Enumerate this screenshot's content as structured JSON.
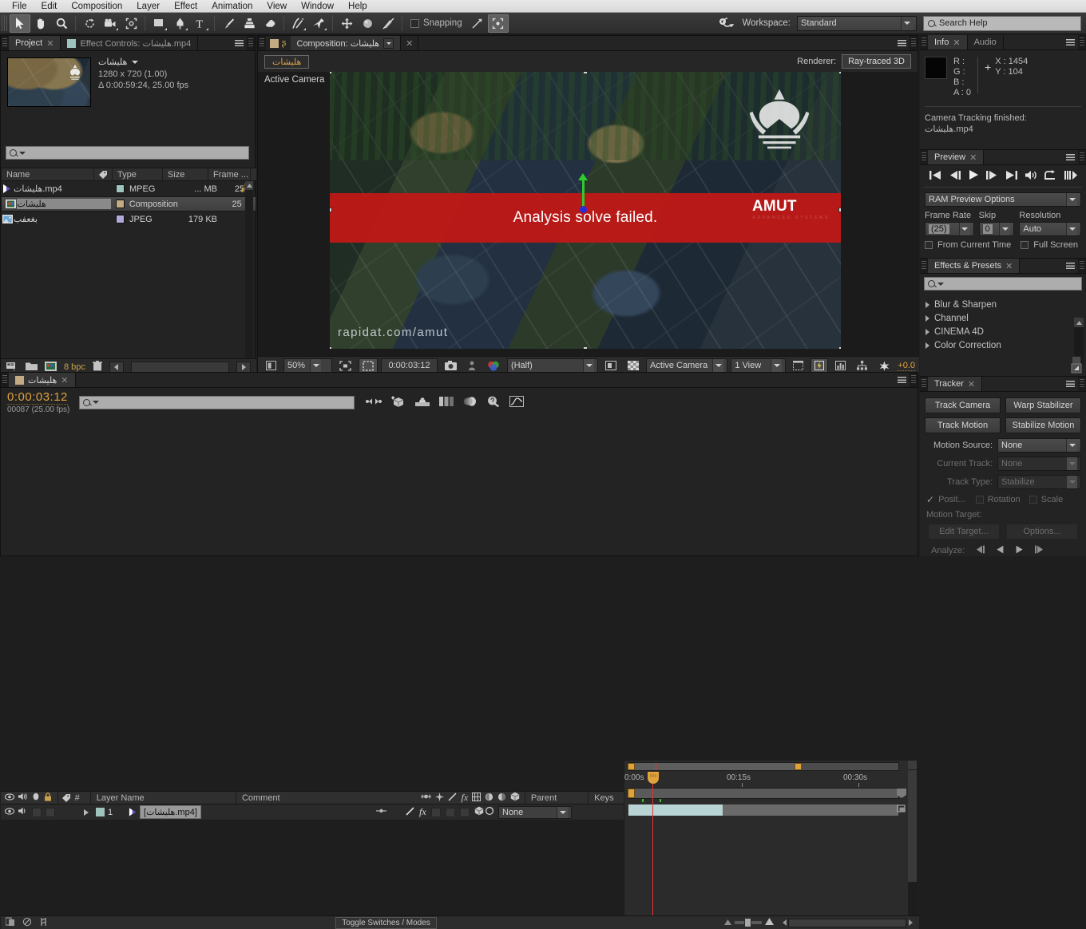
{
  "menu": {
    "items": [
      "File",
      "Edit",
      "Composition",
      "Layer",
      "Effect",
      "Animation",
      "View",
      "Window",
      "Help"
    ]
  },
  "toolbar": {
    "tools": [
      {
        "name": "selection-tool",
        "icon": "arrow",
        "active": true
      },
      {
        "name": "hand-tool",
        "icon": "hand",
        "active": false
      },
      {
        "name": "zoom-tool",
        "icon": "magnifier",
        "active": false
      },
      {
        "name": "rotation-tool",
        "icon": "rotate",
        "active": false
      },
      {
        "name": "camera-tool",
        "icon": "camera",
        "active": false
      },
      {
        "name": "pan-behind-tool",
        "icon": "anchor-region",
        "active": false
      },
      {
        "name": "shape-tool",
        "icon": "rectangle",
        "active": false
      },
      {
        "name": "pen-tool",
        "icon": "pen",
        "active": false
      },
      {
        "name": "type-tool",
        "icon": "type",
        "active": false
      },
      {
        "name": "brush-tool",
        "icon": "brush",
        "active": false
      },
      {
        "name": "clone-stamp-tool",
        "icon": "stamp",
        "active": false
      },
      {
        "name": "eraser-tool",
        "icon": "eraser",
        "active": false
      },
      {
        "name": "roto-brush-tool",
        "icon": "roto-brush",
        "active": false
      },
      {
        "name": "puppet-pin-tool",
        "icon": "pin",
        "active": false
      }
    ],
    "snapping_label": "Snapping",
    "snapping_checked": false,
    "workspace_label": "Workspace:",
    "workspace_value": "Standard",
    "search_help_placeholder": "Search Help"
  },
  "project_panel": {
    "tabs": [
      {
        "label": "Project",
        "active": true,
        "closable": true
      },
      {
        "label": "Effect Controls: هلیشات.mp4",
        "active": false,
        "closable": false
      }
    ],
    "selected_item": {
      "name": "هلیشات",
      "dimensions": "1280 x 720 (1.00)",
      "duration": "Δ 0:00:59:24, 25.00 fps"
    },
    "search_placeholder": "",
    "columns": [
      "Name",
      "Type",
      "Size",
      "Frame ..."
    ],
    "rows": [
      {
        "name": "هلیشات.mp4",
        "type": "MPEG",
        "size": "... MB",
        "frame": "25",
        "color": "#9fc3bd",
        "selected": false,
        "icon": "movie-icon"
      },
      {
        "name": "هلیشات",
        "type": "Composition",
        "size": "",
        "frame": "25",
        "color": "#c3ab83",
        "selected": true,
        "icon": "comp-icon"
      },
      {
        "name": "بغعفب",
        "type": "JPEG",
        "size": "179 KB",
        "frame": "",
        "color": "#b0aad9",
        "selected": false,
        "icon": "image-icon"
      }
    ],
    "bottom_bar": {
      "bit_depth": "8 bpc"
    }
  },
  "composition_panel": {
    "tab_label": "Composition: هلیشات",
    "comp_name_button": "هلیشات",
    "renderer_label": "Renderer:",
    "renderer_value": "Ray-traced 3D",
    "view_label": "Active Camera",
    "error_banner_text": "Analysis solve failed.",
    "error_banner_color": "#c21816",
    "watermark_text": "rapidat.com/amut",
    "logo_text": "AMUT",
    "logo_subtext": "ADVANCED SYSTEMS",
    "bottom_bar": {
      "zoom": "50%",
      "timecode": "0:00:03:12",
      "resolution": "(Half)",
      "camera_view": "Active Camera",
      "view_layout": "1 View",
      "exposure": "+0.0"
    }
  },
  "timeline_panel": {
    "tab_label": "هلیشات",
    "current_time": "0:00:03:12",
    "frame_info": "00087 (25.00 fps)",
    "search_placeholder": "",
    "columns": {
      "number": "#",
      "layer_name": "Layer Name",
      "comment": "Comment",
      "parent": "Parent",
      "keys": "Keys"
    },
    "layers": [
      {
        "index": "1",
        "name": "[هلیشات.mp4]",
        "parent": "None",
        "color": "#9fc3bd"
      }
    ],
    "ruler_labels": [
      "0:00s",
      "00:15s",
      "00:30s"
    ],
    "toggle_switches_label": "Toggle Switches / Modes"
  },
  "info_panel": {
    "tabs": [
      {
        "label": "Info",
        "active": true,
        "closable": true
      },
      {
        "label": "Audio",
        "active": false,
        "closable": false
      }
    ],
    "channels": [
      {
        "label": "R :",
        "value": ""
      },
      {
        "label": "G :",
        "value": ""
      },
      {
        "label": "B :",
        "value": ""
      },
      {
        "label": "A :",
        "value": "0"
      }
    ],
    "coords": [
      {
        "label": "X :",
        "value": "1454"
      },
      {
        "label": "Y :",
        "value": "104"
      }
    ],
    "message_line1": "Camera Tracking finished:",
    "message_line2": "هلیشات.mp4"
  },
  "preview_panel": {
    "tab_label": "Preview",
    "ram_preview_options": "RAM Preview Options",
    "frame_rate_label": "Frame Rate",
    "frame_rate_value": "(25)",
    "skip_label": "Skip",
    "skip_value": "0",
    "resolution_label": "Resolution",
    "resolution_value": "Auto",
    "from_current_time_label": "From Current Time",
    "from_current_time_checked": false,
    "full_screen_label": "Full Screen",
    "full_screen_checked": false,
    "transport_icons": [
      "first-frame-icon",
      "prev-frame-icon",
      "play-icon",
      "next-frame-icon",
      "last-frame-icon",
      "audio-icon",
      "loop-icon",
      "ram-preview-icon"
    ]
  },
  "effects_panel": {
    "tab_label": "Effects & Presets",
    "search_placeholder": "",
    "categories": [
      "Blur & Sharpen",
      "Channel",
      "CINEMA 4D",
      "Color Correction"
    ]
  },
  "tracker_panel": {
    "tab_label": "Tracker",
    "buttons": [
      {
        "label": "Track Camera",
        "disabled": false
      },
      {
        "label": "Warp Stabilizer",
        "disabled": false
      },
      {
        "label": "Track Motion",
        "disabled": false
      },
      {
        "label": "Stabilize Motion",
        "disabled": false
      }
    ],
    "motion_source_label": "Motion Source:",
    "motion_source_value": "None",
    "current_track_label": "Current Track:",
    "current_track_value": "None",
    "track_type_label": "Track Type:",
    "track_type_value": "Stabilize",
    "position_label": "Posit...",
    "position_checked": true,
    "rotation_label": "Rotation",
    "rotation_checked": false,
    "scale_label": "Scale",
    "scale_checked": false,
    "motion_target_label": "Motion Target:",
    "edit_target_label": "Edit Target...",
    "options_label": "Options...",
    "analyze_label": "Analyze:"
  },
  "colors": {
    "accent_orange": "#e0a33c",
    "error_red": "#c21816",
    "panel_bg": "#232323",
    "toolbar_bg": "#2d2d2d",
    "menubar_bg": "#e2e2e2"
  }
}
